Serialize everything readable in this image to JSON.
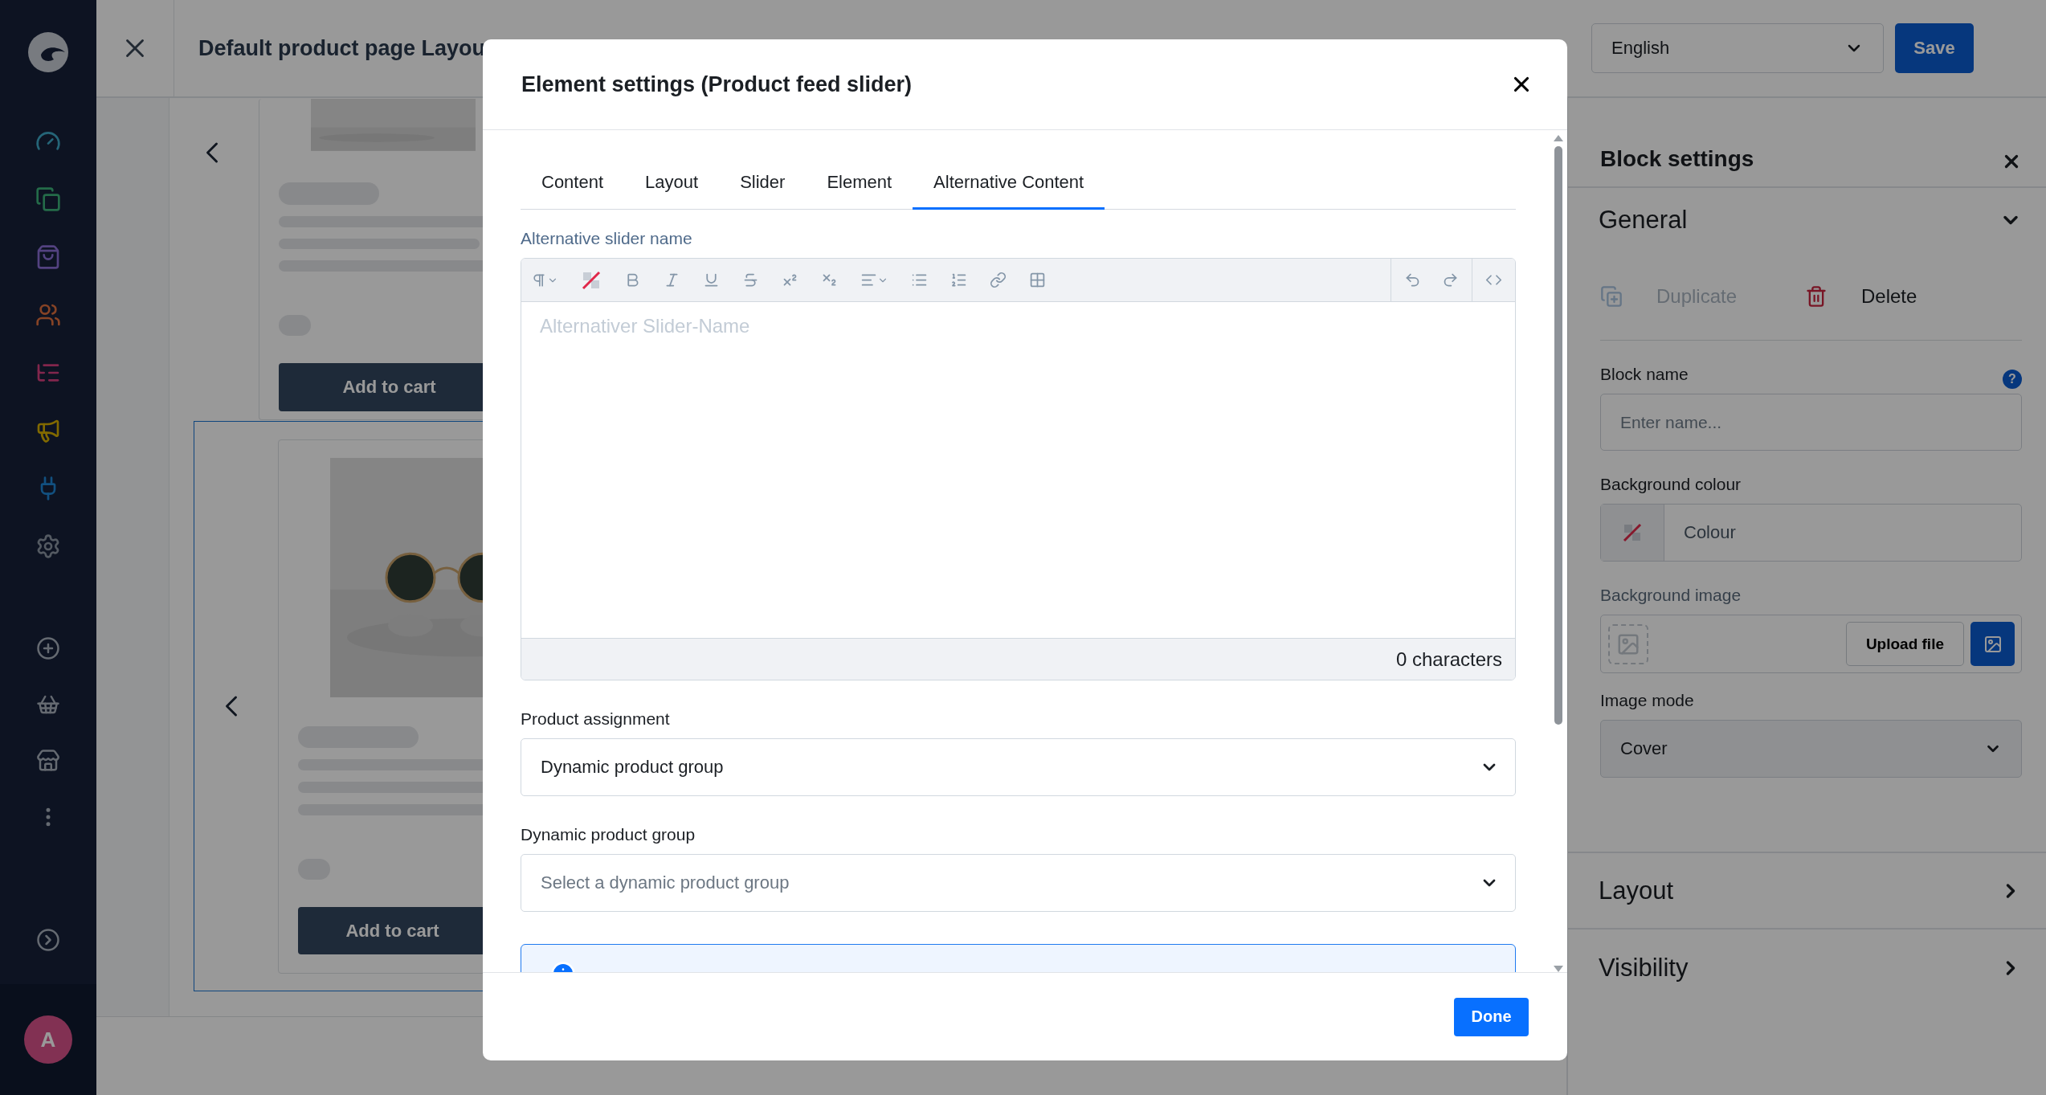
{
  "sidebar": {
    "avatar": "A"
  },
  "topbar": {
    "title": "Default product page Layou",
    "language": "English",
    "save_button": "Save"
  },
  "canvas": {
    "cards": [
      {
        "button": "Add to cart",
        "selected": false
      },
      {
        "button": "Add to cart",
        "selected": true
      }
    ]
  },
  "modal": {
    "title": "Element settings (Product feed slider)",
    "tabs": [
      {
        "label": "Content",
        "selected": false
      },
      {
        "label": "Layout",
        "selected": false
      },
      {
        "label": "Slider",
        "selected": false
      },
      {
        "label": "Element",
        "selected": false
      },
      {
        "label": "Alternative Content",
        "selected": true
      }
    ],
    "editor": {
      "label": "Alternative slider name",
      "placeholder": "Alternativer Slider-Name",
      "counter": "0 characters"
    },
    "selects": [
      {
        "label": "Product assignment",
        "value": "Dynamic product group"
      },
      {
        "label": "Dynamic product group",
        "placeholder": "Select a dynamic product group"
      }
    ],
    "done_button": "Done"
  },
  "block_settings": {
    "title": "Block settings",
    "sections": [
      {
        "title": "General",
        "expanded": true
      },
      {
        "title": "Layout",
        "expanded": false
      },
      {
        "title": "Visibility",
        "expanded": false
      }
    ],
    "actions": [
      {
        "label": "Duplicate",
        "kind": "duplicate",
        "disabled": true
      },
      {
        "label": "Delete",
        "kind": "delete",
        "disabled": false
      }
    ],
    "block_name": {
      "label": "Block name",
      "placeholder": "Enter name...",
      "help": "?"
    },
    "background_colour": {
      "label": "Background colour",
      "placeholder": "Colour"
    },
    "background_image": {
      "label": "Background image",
      "upload_button": "Upload file"
    },
    "image_mode": {
      "label": "Image mode",
      "value": "Cover",
      "disabled": true
    }
  }
}
